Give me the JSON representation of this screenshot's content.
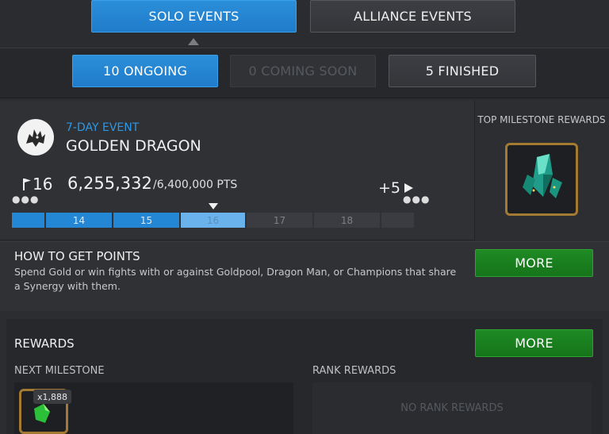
{
  "tabs": {
    "solo_label": "SOLO EVENTS",
    "alliance_label": "ALLIANCE EVENTS"
  },
  "filters": {
    "ongoing_label": "10 ONGOING",
    "coming_soon_label": "0 COMING SOON",
    "finished_label": "5 FINISHED"
  },
  "event": {
    "subtitle": "7-DAY EVENT",
    "title": "GOLDEN DRAGON",
    "current_milestone": "16",
    "points": "6,255,332",
    "points_max": "/6,400,000 PTS",
    "remaining_milestones": "+5",
    "progress_segments": [
      {
        "label": "",
        "state": "full"
      },
      {
        "label": "14",
        "state": "full"
      },
      {
        "label": "15",
        "state": "full"
      },
      {
        "label": "16",
        "state": "current"
      },
      {
        "label": "17",
        "state": "empty"
      },
      {
        "label": "18",
        "state": "empty"
      },
      {
        "label": "",
        "state": "empty"
      }
    ]
  },
  "top_rewards": {
    "title": "TOP MILESTONE REWARDS",
    "icon": "crystal-icon"
  },
  "howto": {
    "title": "HOW TO GET POINTS",
    "description": "Spend Gold or win fights with or against Goldpool, Dragon Man, or Champions that share a Synergy with them.",
    "more_label": "MORE"
  },
  "rewards": {
    "title": "REWARDS",
    "more_label": "MORE",
    "next_milestone_label": "NEXT MILESTONE",
    "rank_rewards_label": "RANK REWARDS",
    "item_count": "x1,888",
    "item_icon": "shard-icon",
    "no_rank_rewards": "NO RANK REWARDS"
  },
  "colors": {
    "accent_blue": "#2387d6",
    "green": "#1f8a24",
    "gold_frame": "#a37a32"
  }
}
